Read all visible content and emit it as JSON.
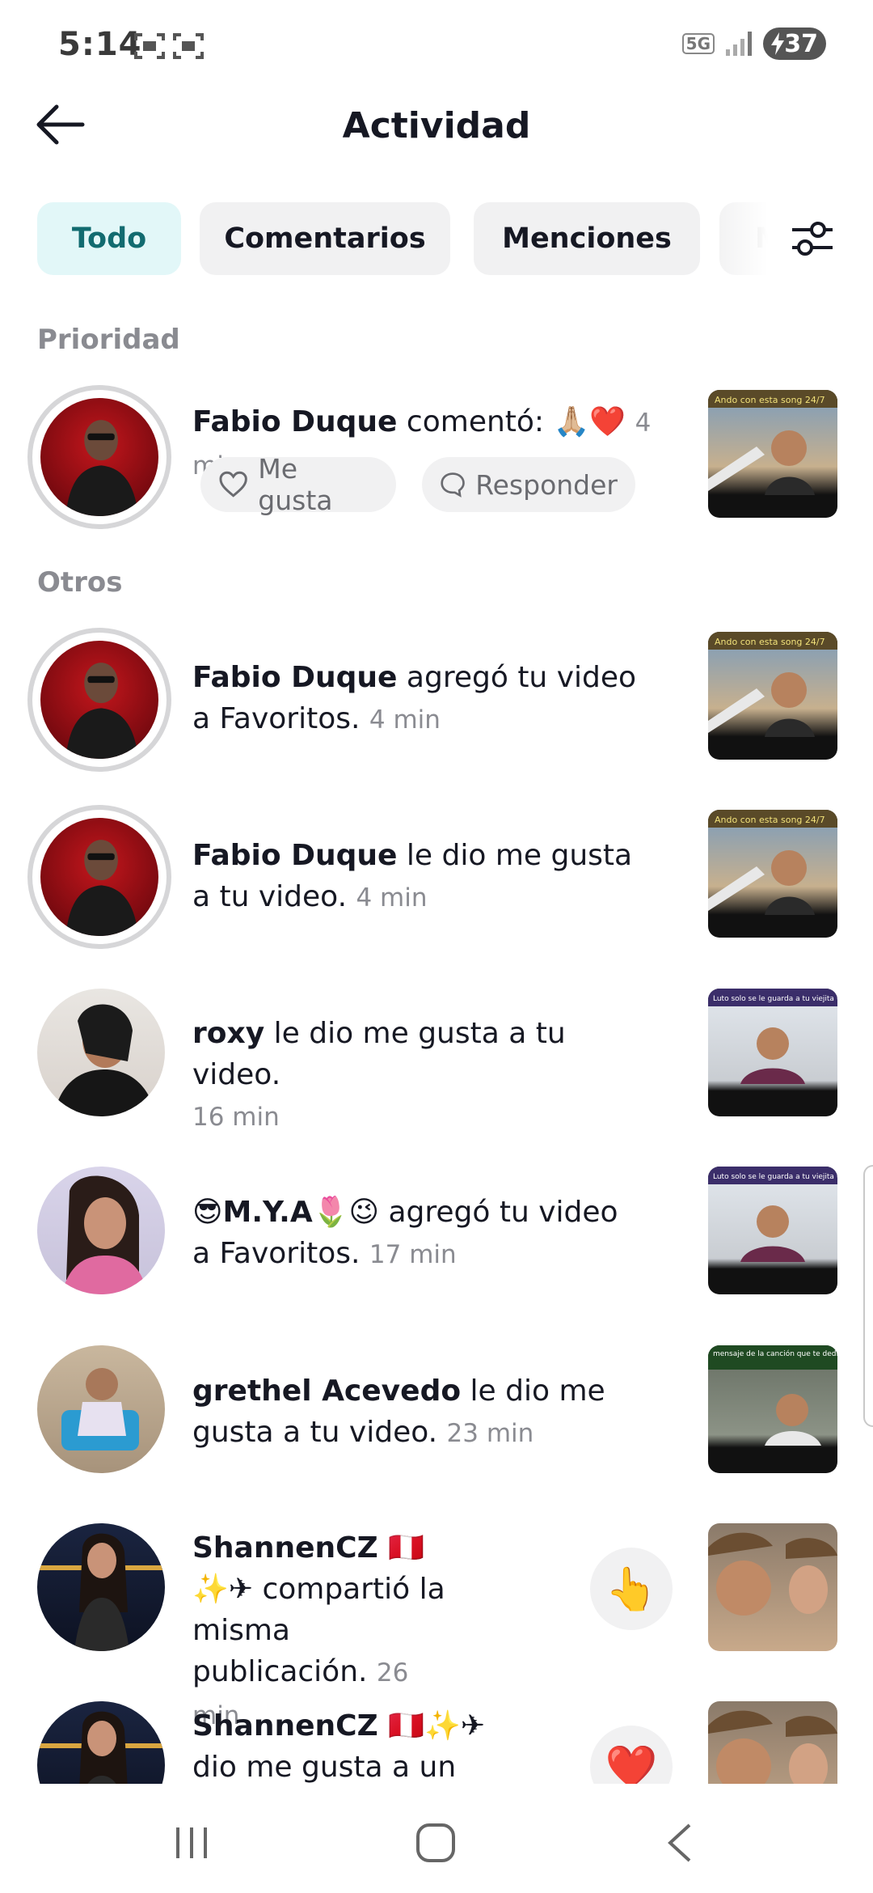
{
  "status_bar": {
    "time": "5:14",
    "network": "5G",
    "battery": "37"
  },
  "header": {
    "title": "Actividad"
  },
  "tabs": [
    {
      "label": "Todo",
      "active": true
    },
    {
      "label": "Comentarios",
      "active": false
    },
    {
      "label": "Menciones",
      "active": false
    },
    {
      "label": "M",
      "active": false
    }
  ],
  "sections": {
    "priority": "Prioridad",
    "others": "Otros"
  },
  "priority_item": {
    "username": "Fabio Duque",
    "action": " comentó: 🙏🏼❤️",
    "time": "4 min",
    "like_label": "Me gusta",
    "reply_label": "Responder",
    "thumb_caption": "Ando con esta song 24/7"
  },
  "items": [
    {
      "username": "Fabio Duque",
      "action": " agregó tu video a Favoritos.",
      "time": "4 min",
      "thumb_caption": "Ando con esta song 24/7"
    },
    {
      "username": "Fabio Duque",
      "action": " le dio me gusta a tu video.",
      "time": "4 min",
      "thumb_caption": "Ando con esta song 24/7"
    },
    {
      "username": "roxy",
      "action": " le dio me gusta a tu video.",
      "time": "16 min",
      "thumb_caption": "Luto solo se le guarda a tu viejita 😎"
    },
    {
      "username": "😎M.Y.A🌷😉",
      "action": " agregó tu video a Favoritos.",
      "time": "17 min",
      "thumb_caption": "Luto solo se le guarda a tu viejita 😎"
    },
    {
      "username": "grethel Acevedo",
      "action": " le dio me gusta a tu video.",
      "time": "23 min",
      "thumb_caption": "mensaje de la canción que te dedicaron 😂"
    },
    {
      "username": "ShannenCZ 🇵🇪✨✈",
      "action": " compartió la misma publicación.",
      "time": "26 min",
      "reaction": "👆"
    },
    {
      "username": "ShannenCZ 🇵🇪✨✈",
      "action": " dio me gusta a un video que",
      "time": "",
      "reaction": "❤️"
    }
  ],
  "colors": {
    "accent_tab_bg": "#e2f7f8",
    "accent_tab_text": "#126b70",
    "heart": "#fe2c55"
  }
}
